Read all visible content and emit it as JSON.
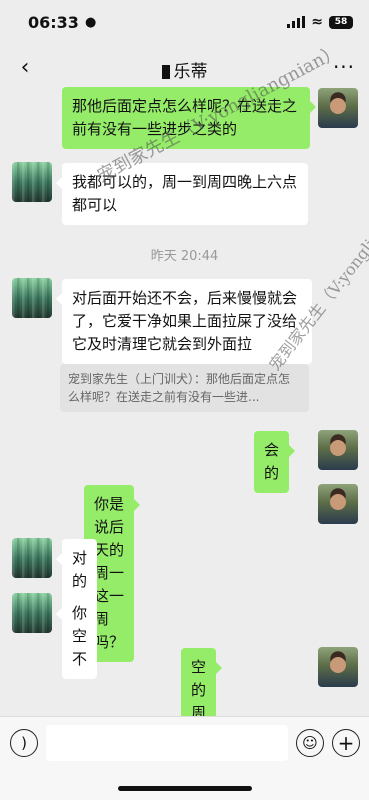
{
  "status_bar": {
    "time": "06:33",
    "battery": "58"
  },
  "header": {
    "contact_name": "乐蒂",
    "back_icon": "chevron-left-icon",
    "more_icon": "ellipsis-icon"
  },
  "messages": [
    {
      "side": "out",
      "text": "那他后面定点怎么样呢？在送走之前有没有一些进步之类的"
    },
    {
      "side": "in",
      "text": "我都可以的，周一到周四晚上六点都可以"
    },
    {
      "side": "in",
      "text": "对后面开始还不会，后来慢慢就会了，它爱干净如果上面拉屎了没给它及时清理它就会到外面拉"
    },
    {
      "side": "out",
      "text": "会的"
    },
    {
      "side": "out",
      "text": "你是说后天的周一这一周吗？"
    },
    {
      "side": "in",
      "text": "对的"
    },
    {
      "side": "in",
      "text": "你空不"
    },
    {
      "side": "out",
      "text": "空的 周一也ok"
    }
  ],
  "timestamp": "昨天 20:44",
  "quote": {
    "text": "宠到家先生（上门训犬）：那他后面定点怎么样呢？在送走之前有没有一些进..."
  },
  "input_bar": {
    "voice_icon": "voice-icon",
    "emoji_icon": "emoji-icon",
    "plus_icon": "plus-icon"
  },
  "watermarks": [
    "宠到家先生（V:yongliangnian）",
    "宠到家先生（V:yongliangnian）",
    "（V:yongliangnian）"
  ]
}
